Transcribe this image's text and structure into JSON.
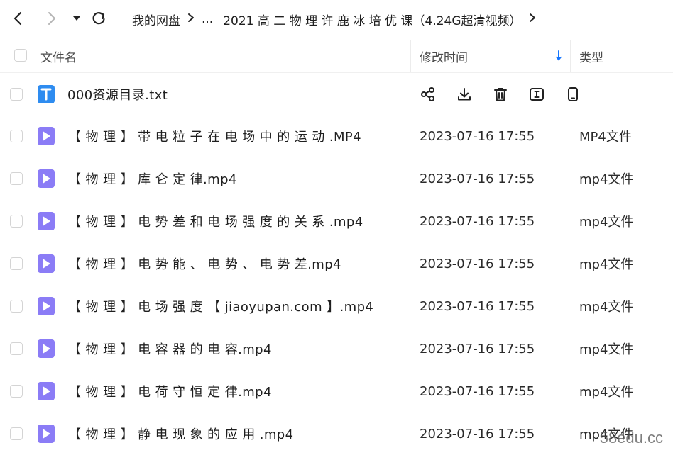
{
  "breadcrumb": {
    "root": "我的网盘",
    "ellipsis": "...",
    "current": "2021 高 二 物 理 许 鹿 冰 培 优 课（4.24G超清视频）"
  },
  "header": {
    "filename": "文件名",
    "modified": "修改时间",
    "type": "类型"
  },
  "files": [
    {
      "name": "000资源目录.txt",
      "time": "",
      "type": "",
      "icon": "txt-file-icon",
      "hovered": true
    },
    {
      "name": "【 物 理 】 带 电 粒 子 在 电 场 中 的 运 动 .MP4",
      "time": "2023-07-16 17:55",
      "type": "MP4文件",
      "icon": "video-file-icon"
    },
    {
      "name": "【 物 理 】 库 仑 定 律.mp4",
      "time": "2023-07-16 17:55",
      "type": "mp4文件",
      "icon": "video-file-icon"
    },
    {
      "name": "【 物 理 】 电 势 差 和 电 场 强 度 的 关 系 .mp4",
      "time": "2023-07-16 17:55",
      "type": "mp4文件",
      "icon": "video-file-icon"
    },
    {
      "name": "【 物 理 】 电 势 能 、 电 势 、 电 势 差.mp4",
      "time": "2023-07-16 17:55",
      "type": "mp4文件",
      "icon": "video-file-icon"
    },
    {
      "name": "【 物 理 】 电 场 强 度 【 jiaoyupan.com 】.mp4",
      "time": "2023-07-16 17:55",
      "type": "mp4文件",
      "icon": "video-file-icon"
    },
    {
      "name": "【 物 理 】 电 容 器 的 电 容.mp4",
      "time": "2023-07-16 17:55",
      "type": "mp4文件",
      "icon": "video-file-icon"
    },
    {
      "name": "【 物 理 】 电 荷 守 恒 定 律.mp4",
      "time": "2023-07-16 17:55",
      "type": "mp4文件",
      "icon": "video-file-icon"
    },
    {
      "name": "【 物 理 】 静 电 现 象 的 应 用 .mp4",
      "time": "2023-07-16 17:55",
      "type": "mp4文件",
      "icon": "video-file-icon"
    }
  ],
  "watermark": "58edu.cc",
  "colors": {
    "accent": "#1677ff",
    "video_icon": "#8b7cf6",
    "txt_icon": "#2e8cf0"
  }
}
